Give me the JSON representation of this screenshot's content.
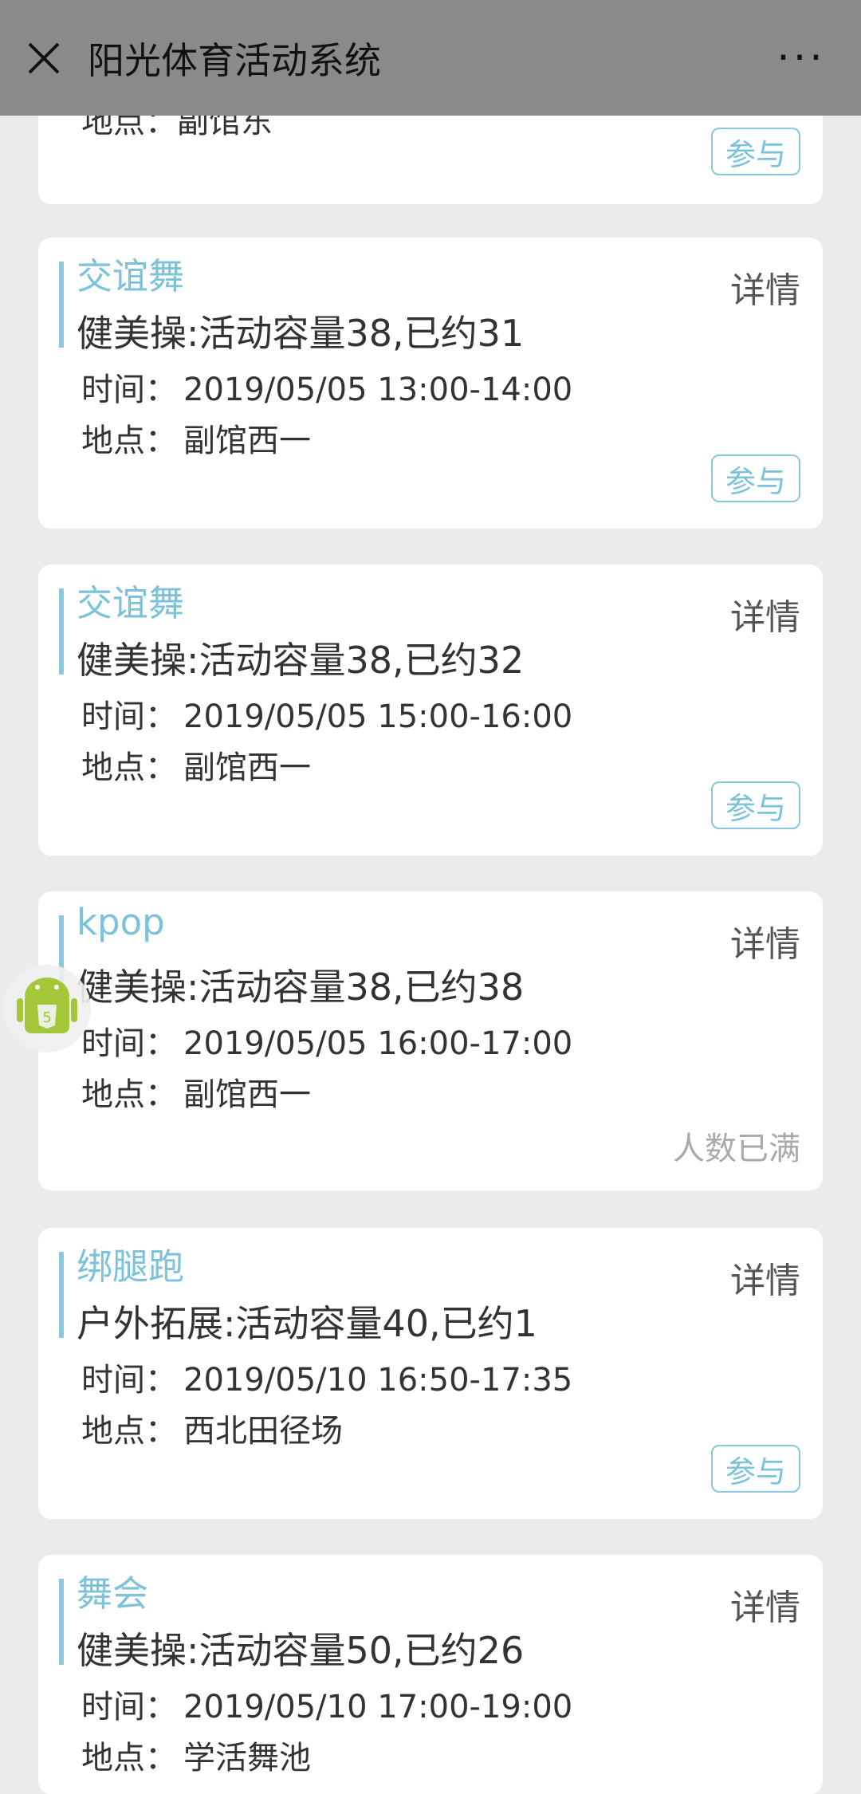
{
  "header": {
    "close_icon": "close-icon",
    "title": "阳光体育活动系统",
    "more_icon": "more-horizontal-icon",
    "more_glyph": "···"
  },
  "partial_card": {
    "location_label": "地点：",
    "location": "副馆东",
    "join_label": "参与"
  },
  "labels": {
    "detail": "详情",
    "time": "时间：",
    "location": "地点：",
    "join": "参与",
    "full": "人数已满"
  },
  "activities": [
    {
      "name": "交谊舞",
      "category": "健美操",
      "colon": ":",
      "capacity_text": "活动容量",
      "capacity": "38",
      "booked_text": ",已约",
      "booked": "31",
      "time": "2019/05/05 13:00-14:00",
      "location": "副馆西一",
      "status": "join"
    },
    {
      "name": "交谊舞",
      "category": "健美操",
      "colon": ":",
      "capacity_text": "活动容量",
      "capacity": "38",
      "booked_text": ",已约",
      "booked": "32",
      "time": "2019/05/05 15:00-16:00",
      "location": "副馆西一",
      "status": "join"
    },
    {
      "name": "kpop",
      "category": "健美操",
      "colon": ":",
      "capacity_text": "活动容量",
      "capacity": "38",
      "booked_text": ",已约",
      "booked": "38",
      "time": "2019/05/05 16:00-17:00",
      "location": "副馆西一",
      "status": "full"
    },
    {
      "name": "绑腿跑",
      "category": "户外拓展",
      "colon": ":",
      "capacity_text": "活动容量",
      "capacity": "40",
      "booked_text": ",已约",
      "booked": "1",
      "time": "2019/05/10 16:50-17:35",
      "location": "西北田径场",
      "status": "join"
    },
    {
      "name": "舞会",
      "category": "健美操",
      "colon": ":",
      "capacity_text": "活动容量",
      "capacity": "50",
      "booked_text": ",已约",
      "booked": "26",
      "time": "2019/05/10 17:00-19:00",
      "location": "学活舞池",
      "status": "join"
    }
  ],
  "colors": {
    "accent": "#7cc2da",
    "header_bg": "#8a8a8a",
    "page_bg": "#ebebeb"
  },
  "floating_icon": "android-html5-icon"
}
